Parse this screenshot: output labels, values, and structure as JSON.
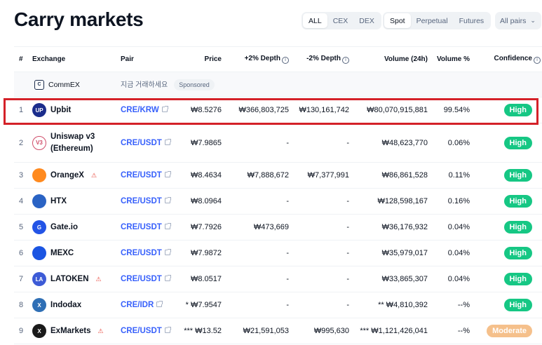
{
  "page": {
    "title": "Carry markets"
  },
  "filters": {
    "type_tabs": [
      "ALL",
      "CEX",
      "DEX"
    ],
    "type_active": "ALL",
    "market_tabs": [
      "Spot",
      "Perpetual",
      "Futures"
    ],
    "market_active": "Spot",
    "pairs_select": {
      "value": "All pairs",
      "icon": "chevron-down-icon"
    }
  },
  "columns": {
    "rank": "#",
    "exchange": "Exchange",
    "pair": "Pair",
    "price": "Price",
    "depth_plus": "+2% Depth",
    "depth_minus": "-2% Depth",
    "volume": "Volume (24h)",
    "volume_pct": "Volume %",
    "confidence": "Confidence"
  },
  "sponsored": {
    "exchange": "CommEX",
    "pair_text": "지금 거래하세요",
    "badge": "Sponsored"
  },
  "rows": [
    {
      "rank": "1",
      "exchange": "Upbit",
      "logo_color": "#1b2d8c",
      "logo_text": "UP",
      "warning": false,
      "pair": "CRE/KRW",
      "price": "₩8.5276",
      "depth_plus": "₩366,803,725",
      "depth_minus": "₩130,161,742",
      "volume": "₩80,070,915,881",
      "volume_pct": "99.54%",
      "confidence": "High"
    },
    {
      "rank": "2",
      "exchange": "Uniswap v3 (Ethereum)",
      "logo_color": "#ffffff",
      "logo_text": "V3",
      "warning": false,
      "pair": "CRE/USDT",
      "price": "₩7.9865",
      "depth_plus": "-",
      "depth_minus": "-",
      "volume": "₩48,623,770",
      "volume_pct": "0.06%",
      "confidence": "High"
    },
    {
      "rank": "3",
      "exchange": "OrangeX",
      "logo_color": "#ff8a1f",
      "logo_text": "",
      "warning": true,
      "pair": "CRE/USDT",
      "price": "₩8.4634",
      "depth_plus": "₩7,888,672",
      "depth_minus": "₩7,377,991",
      "volume": "₩86,861,528",
      "volume_pct": "0.11%",
      "confidence": "High"
    },
    {
      "rank": "4",
      "exchange": "HTX",
      "logo_color": "#2a63c4",
      "logo_text": "",
      "warning": false,
      "pair": "CRE/USDT",
      "price": "₩8.0964",
      "depth_plus": "-",
      "depth_minus": "-",
      "volume": "₩128,598,167",
      "volume_pct": "0.16%",
      "confidence": "High"
    },
    {
      "rank": "5",
      "exchange": "Gate.io",
      "logo_color": "#2354e6",
      "logo_text": "G",
      "warning": false,
      "pair": "CRE/USDT",
      "price": "₩7.7926",
      "depth_plus": "₩473,669",
      "depth_minus": "-",
      "volume": "₩36,176,932",
      "volume_pct": "0.04%",
      "confidence": "High"
    },
    {
      "rank": "6",
      "exchange": "MEXC",
      "logo_color": "#1b55e2",
      "logo_text": "",
      "warning": false,
      "pair": "CRE/USDT",
      "price": "₩7.9872",
      "depth_plus": "-",
      "depth_minus": "-",
      "volume": "₩35,979,017",
      "volume_pct": "0.04%",
      "confidence": "High"
    },
    {
      "rank": "7",
      "exchange": "LATOKEN",
      "logo_color": "#3d5bd6",
      "logo_text": "LA",
      "warning": true,
      "pair": "CRE/USDT",
      "price": "₩8.0517",
      "depth_plus": "-",
      "depth_minus": "-",
      "volume": "₩33,865,307",
      "volume_pct": "0.04%",
      "confidence": "High"
    },
    {
      "rank": "8",
      "exchange": "Indodax",
      "logo_color": "#2f6fb5",
      "logo_text": "X",
      "warning": false,
      "pair": "CRE/IDR",
      "price": "* ₩7.9547",
      "depth_plus": "-",
      "depth_minus": "-",
      "volume": "** ₩4,810,392",
      "volume_pct": "--%",
      "confidence": "High"
    },
    {
      "rank": "9",
      "exchange": "ExMarkets",
      "logo_color": "#1a1a1a",
      "logo_text": "X",
      "warning": true,
      "pair": "CRE/USDT",
      "price": "*** ₩13.52",
      "depth_plus": "₩21,591,053",
      "depth_minus": "₩995,630",
      "volume": "*** ₩1,121,426,041",
      "volume_pct": "--%",
      "confidence": "Moderate"
    }
  ]
}
